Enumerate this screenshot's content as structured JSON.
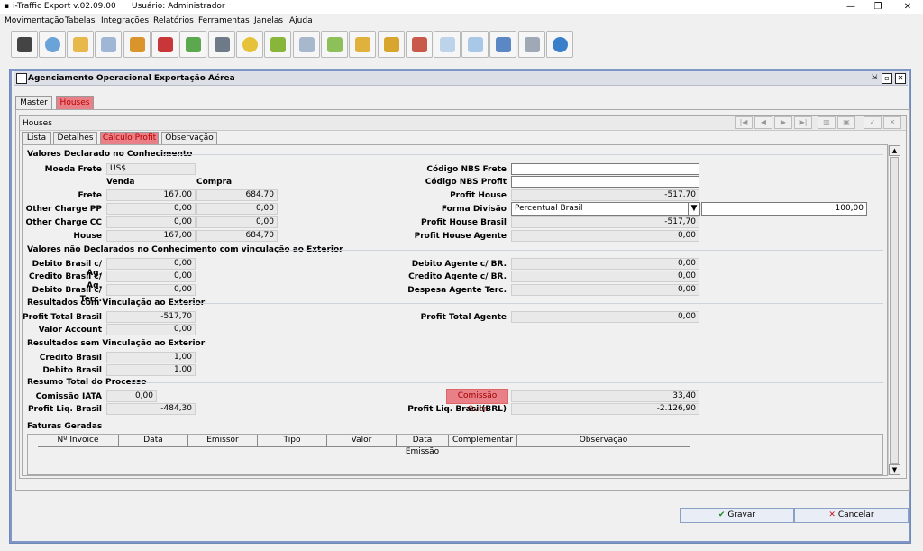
{
  "window": {
    "title": "i-Traffic Export  v.02.09.00",
    "user": "Usuário: Administrador"
  },
  "menu": [
    "Movimentação",
    "Tabelas",
    "Integrações",
    "Relatórios",
    "Ferramentas",
    "Janelas",
    "Ajuda"
  ],
  "toolbar_icons": [
    "folder-dark-icon",
    "clock-icon",
    "open-folder-icon",
    "airplane-icon",
    "export-folder-icon",
    "ship-icon",
    "check-icon",
    "document-icon",
    "coins-icon",
    "arrow-up-icon",
    "files-icon",
    "money-icon",
    "money-stack-icon",
    "money-arrow-icon",
    "money-search-icon",
    "frame-icon",
    "panel-icon",
    "chart-icon",
    "list-icon",
    "play-icon"
  ],
  "internal": {
    "title": "Agenciamento Operacional Exportação Aérea"
  },
  "tabs": [
    "Master",
    "Houses"
  ],
  "houses": {
    "title": "Houses"
  },
  "subtabs": [
    "Lista",
    "Detalhes",
    "Cálculo Profit",
    "Observação"
  ],
  "sections": {
    "declared": "Valores Declarado no Conhecimento",
    "not_declared": "Valores não Declarados no Conhecimento com vinculação ao Exterior",
    "with_link": "Resultados com Vinculação ao Exterior",
    "without_link": "Resultados  sem Vinculação ao Exterior",
    "summary": "Resumo Total do Processo",
    "invoices": "Faturas Geradas"
  },
  "declared": {
    "moeda_label": "Moeda Frete",
    "moeda_value": "US$",
    "col_venda": "Venda",
    "col_compra": "Compra",
    "rows": [
      {
        "label": "Frete",
        "venda": "167,00",
        "compra": "684,70"
      },
      {
        "label": "Other Charge PP",
        "venda": "0,00",
        "compra": "0,00"
      },
      {
        "label": "Other Charge CC",
        "venda": "0,00",
        "compra": "0,00"
      },
      {
        "label": "House",
        "venda": "167,00",
        "compra": "684,70"
      }
    ],
    "nbs_frete_label": "Código NBS Frete",
    "nbs_frete": "",
    "nbs_profit_label": "Código NBS Profit",
    "nbs_profit": "",
    "profit_house_label": "Profit House",
    "profit_house": "-517,70",
    "forma_label": "Forma Divisão",
    "forma_value": "Percentual Brasil",
    "forma_pct": "100,00",
    "phb_label": "Profit House Brasil",
    "phb": "-517,70",
    "pha_label": "Profit House Agente",
    "pha": "0,00"
  },
  "not_declared": {
    "left": [
      {
        "label": "Debito Brasil c/ Ag.",
        "value": "0,00"
      },
      {
        "label": "Credito Brasil c/ Ag.",
        "value": "0,00"
      },
      {
        "label": "Debito Brasil c/ Terc.",
        "value": "0,00"
      }
    ],
    "right": [
      {
        "label": "Debito Agente c/ BR.",
        "value": "0,00"
      },
      {
        "label": "Credito Agente c/ BR.",
        "value": "0,00"
      },
      {
        "label": "Despesa Agente Terc.",
        "value": "0,00"
      }
    ]
  },
  "with_link": {
    "ptb_label": "Profit Total Brasil",
    "ptb": "-517,70",
    "va_label": "Valor Account",
    "va": "0,00",
    "pta_label": "Profit Total Agente",
    "pta": "0,00"
  },
  "without_link": {
    "cb_label": "Credito Brasil",
    "cb": "1,00",
    "db_label": "Debito Brasil",
    "db": "1,00"
  },
  "summary": {
    "iata_label": "Comissão IATA",
    "iata": "0,00",
    "plb_label": "Profit Liq. Brasil",
    "plb": "-484,30",
    "over_label": "Comissão Over",
    "over": "33,40",
    "plbrl_label": "Profit Liq. Brasil(BRL)",
    "plbrl": "-2.126,90"
  },
  "grid_headers": [
    "Nº Invoice",
    "Data",
    "Emissor",
    "Tipo",
    "Valor",
    "Data Emissão",
    "Complementar",
    "Observação"
  ],
  "buttons": {
    "save": "Gravar",
    "cancel": "Cancelar"
  }
}
